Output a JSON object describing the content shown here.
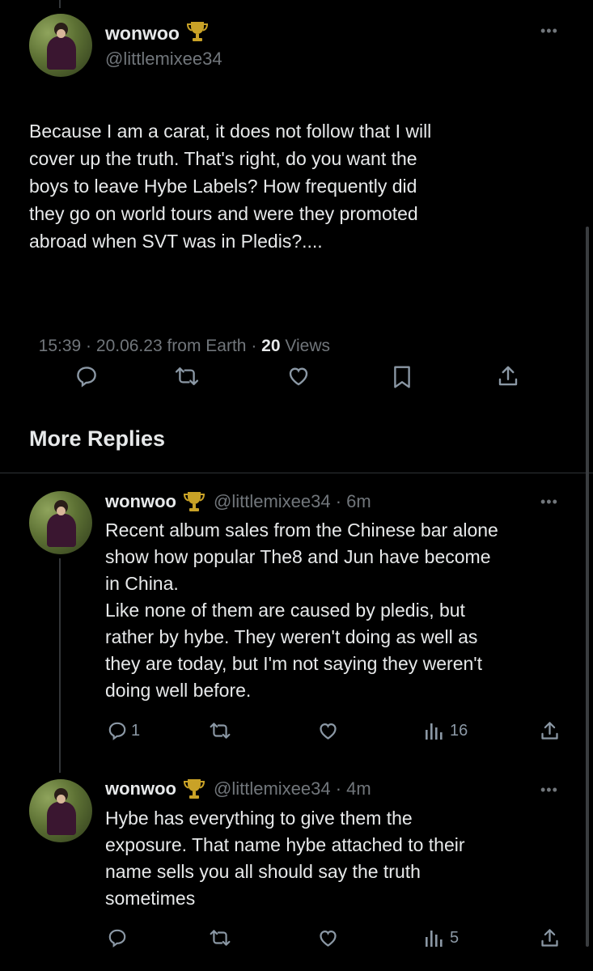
{
  "main_tweet": {
    "author_name": "wonwoo",
    "author_handle": "@littlemixee34",
    "text": "Because I am a carat, it does not follow that I will\ncover up the truth. That's right, do you want the\nboys to leave Hybe Labels? How frequently did\nthey go on world tours and were they promoted\nabroad when SVT was in Pledis?....",
    "meta_time": "15:39 · 20.06.23 from Earth · ",
    "views_count": "20",
    "views_label": " Views"
  },
  "section_title": "More Replies",
  "replies": [
    {
      "author_name": "wonwoo",
      "author_handle": "@littlemixee34",
      "time": " · 6m",
      "text": "Recent album sales from the Chinese bar alone\nshow how popular The8 and Jun have become\nin China.\nLike none of them are caused by pledis, but\nrather by hybe. They weren't doing as well as\nthey are today, but I'm not saying they weren't\ndoing well before.",
      "reply_count": "1",
      "views_count": "16"
    },
    {
      "author_name": "wonwoo",
      "author_handle": "@littlemixee34",
      "time": " · 4m",
      "text": "Hybe has everything to give them the\nexposure. That name hybe attached to their\nname sells you all should say the truth\nsometimes",
      "reply_count": "",
      "views_count": "5"
    }
  ],
  "icons": {
    "trophy": "trophy-icon",
    "more": "more-icon",
    "reply": "reply-icon",
    "retweet": "retweet-icon",
    "like": "like-icon",
    "bookmark": "bookmark-icon",
    "share": "share-icon",
    "views": "views-icon"
  },
  "colors": {
    "background": "#000000",
    "text": "#e7e9ea",
    "muted": "#71767b",
    "divider": "#2f3336",
    "trophy": "#c9a227"
  }
}
